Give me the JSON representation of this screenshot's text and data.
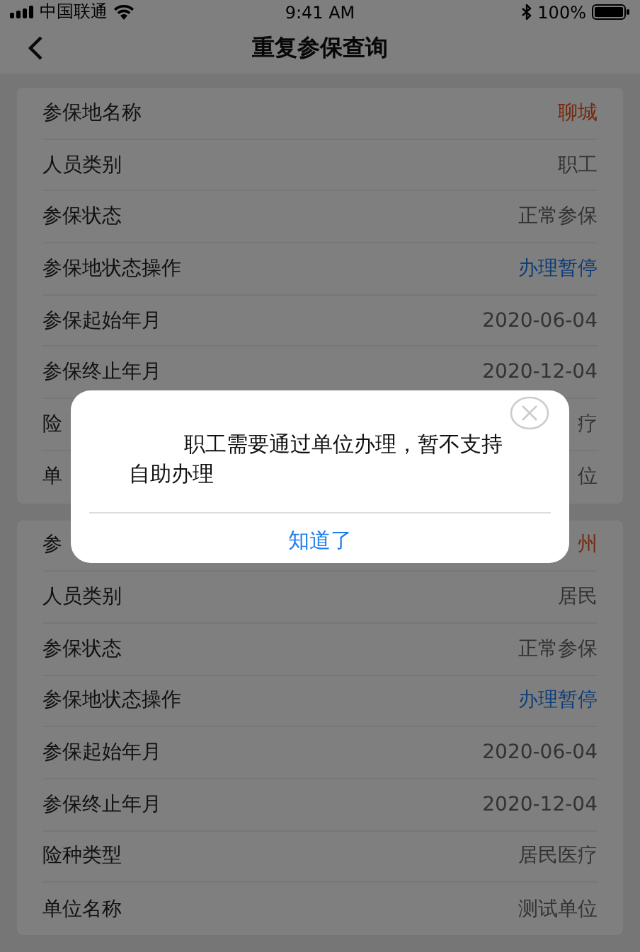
{
  "status_bar": {
    "carrier": "中国联通",
    "time": "9:41 AM",
    "battery": "100%"
  },
  "nav_bar": {
    "title": "重复参保查询"
  },
  "cards": [
    {
      "rows": [
        {
          "label": "参保地名称",
          "value": "聊城",
          "kind": "accent"
        },
        {
          "label": "人员类别",
          "value": "职工",
          "kind": "plain"
        },
        {
          "label": "参保状态",
          "value": "正常参保",
          "kind": "plain"
        },
        {
          "label": "参保地状态操作",
          "value": "办理暂停",
          "kind": "link"
        },
        {
          "label": "参保起始年月",
          "value": "2020-06-04",
          "kind": "plain"
        },
        {
          "label": "参保终止年月",
          "value": "2020-12-04",
          "kind": "plain"
        },
        {
          "label": "险",
          "value": "疗",
          "kind": "plain"
        },
        {
          "label": "单",
          "value": "位",
          "kind": "plain"
        }
      ]
    },
    {
      "rows": [
        {
          "label": "参",
          "value": "州",
          "kind": "accent"
        },
        {
          "label": "人员类别",
          "value": "居民",
          "kind": "plain"
        },
        {
          "label": "参保状态",
          "value": "正常参保",
          "kind": "plain"
        },
        {
          "label": "参保地状态操作",
          "value": "办理暂停",
          "kind": "link"
        },
        {
          "label": "参保起始年月",
          "value": "2020-06-04",
          "kind": "plain"
        },
        {
          "label": "参保终止年月",
          "value": "2020-12-04",
          "kind": "plain"
        },
        {
          "label": "险种类型",
          "value": "居民医疗",
          "kind": "plain"
        },
        {
          "label": "单位名称",
          "value": "测试单位",
          "kind": "plain"
        }
      ]
    }
  ],
  "dialog": {
    "message": "职工需要通过单位办理，暂不支持自助办理",
    "button": "知道了"
  }
}
